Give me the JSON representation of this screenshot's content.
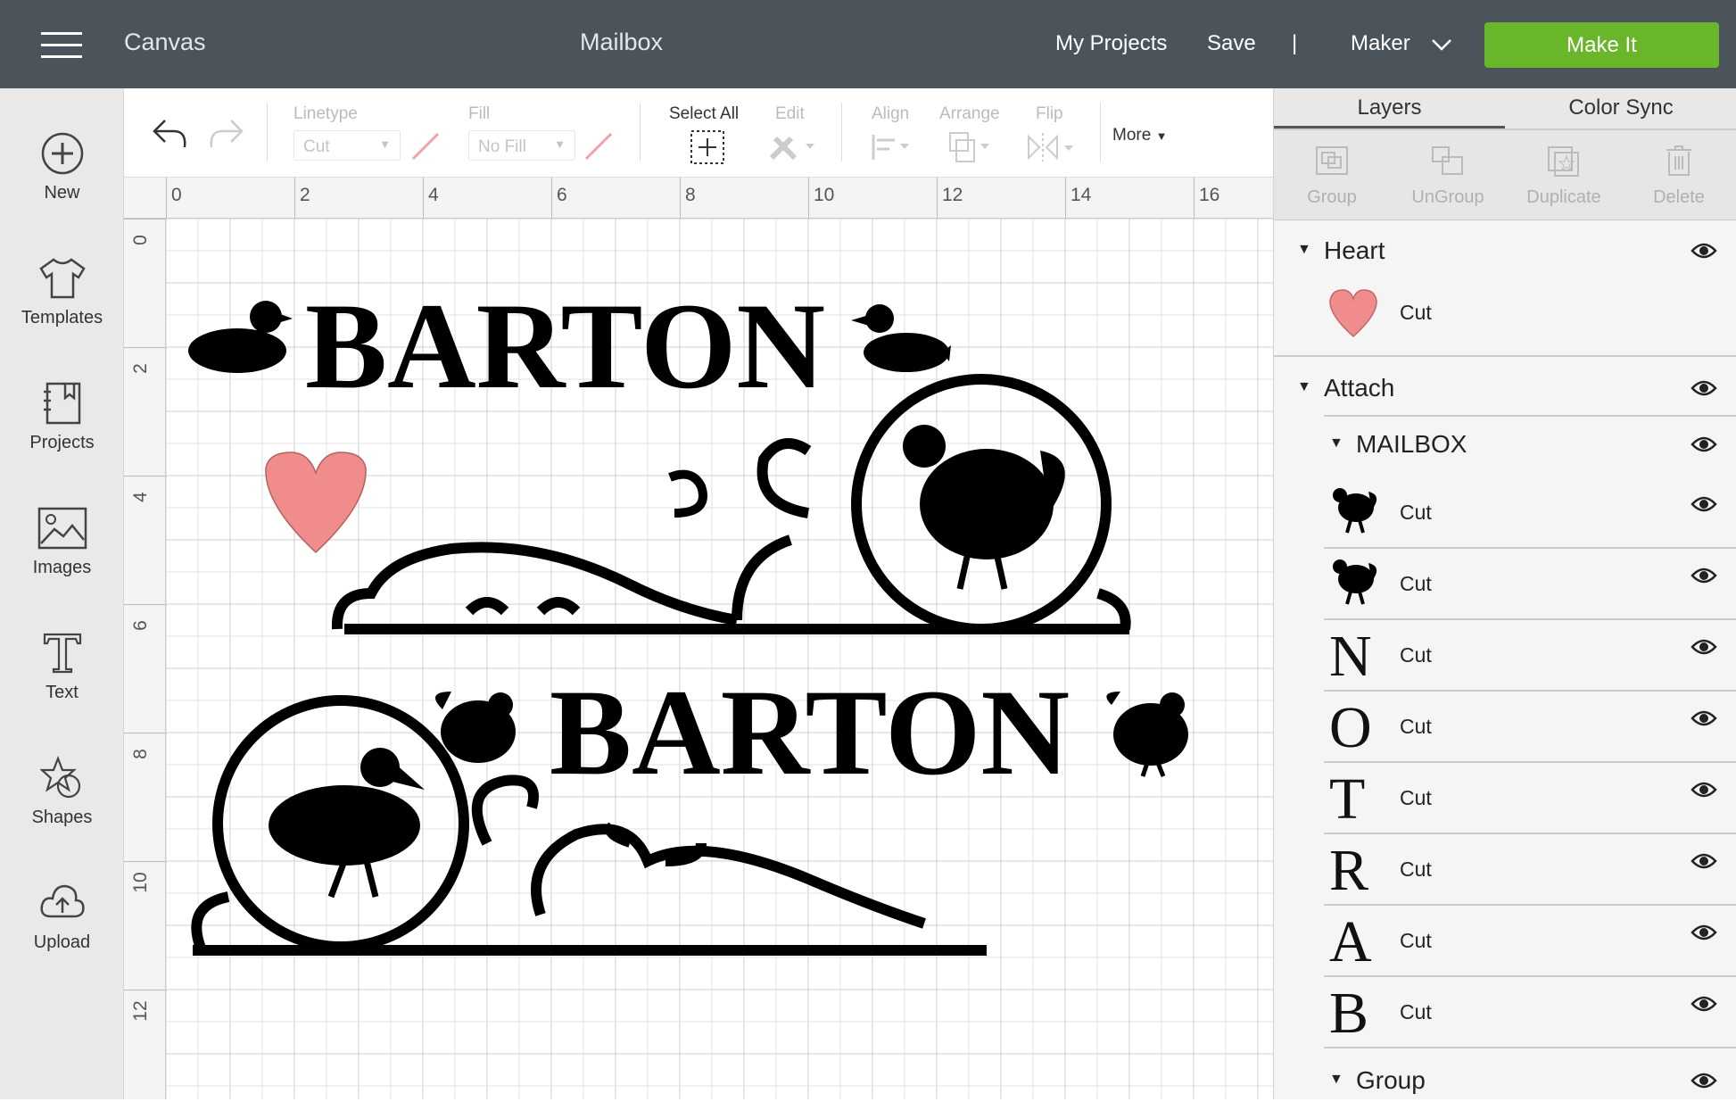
{
  "topbar": {
    "menu_icon": "hamburger-icon",
    "app": "Canvas",
    "project_title": "Mailbox",
    "my_projects": "My Projects",
    "save": "Save",
    "divider": "|",
    "machine": "Maker",
    "make_it": "Make It",
    "make_it_color": "#6ab62a"
  },
  "sidebar": {
    "items": [
      {
        "label": "New",
        "icon": "plus-circle-icon"
      },
      {
        "label": "Templates",
        "icon": "tshirt-icon"
      },
      {
        "label": "Projects",
        "icon": "notebook-icon"
      },
      {
        "label": "Images",
        "icon": "image-icon"
      },
      {
        "label": "Text",
        "icon": "text-icon"
      },
      {
        "label": "Shapes",
        "icon": "shapes-icon"
      },
      {
        "label": "Upload",
        "icon": "cloud-upload-icon"
      }
    ]
  },
  "toolbar": {
    "linetype_label": "Linetype",
    "linetype_value": "Cut",
    "fill_label": "Fill",
    "fill_value": "No Fill",
    "select_all": "Select All",
    "edit": "Edit",
    "align": "Align",
    "arrange": "Arrange",
    "flip": "Flip",
    "more": "More"
  },
  "rulers": {
    "top": [
      "0",
      "2",
      "4",
      "6",
      "8",
      "10",
      "12",
      "14",
      "16"
    ],
    "left": [
      "0",
      "2",
      "4",
      "6",
      "8",
      "10",
      "12"
    ]
  },
  "canvas": {
    "text1": "BARTON",
    "text2": "BARTON",
    "heart_color": "#f08c8c"
  },
  "panel": {
    "tabs": [
      "Layers",
      "Color Sync"
    ],
    "tools": [
      "Group",
      "UnGroup",
      "Duplicate",
      "Delete"
    ],
    "layers": {
      "heart_group": "Heart",
      "heart_item": "Cut",
      "attach_group": "Attach",
      "mailbox_group": "MAILBOX",
      "items": [
        {
          "thumb": "chicken",
          "label": "Cut"
        },
        {
          "thumb": "chicken",
          "label": "Cut"
        },
        {
          "thumb": "N",
          "label": "Cut"
        },
        {
          "thumb": "O",
          "label": "Cut"
        },
        {
          "thumb": "T",
          "label": "Cut"
        },
        {
          "thumb": "R",
          "label": "Cut"
        },
        {
          "thumb": "A",
          "label": "Cut"
        },
        {
          "thumb": "B",
          "label": "Cut"
        }
      ],
      "last_group": "Group"
    }
  }
}
